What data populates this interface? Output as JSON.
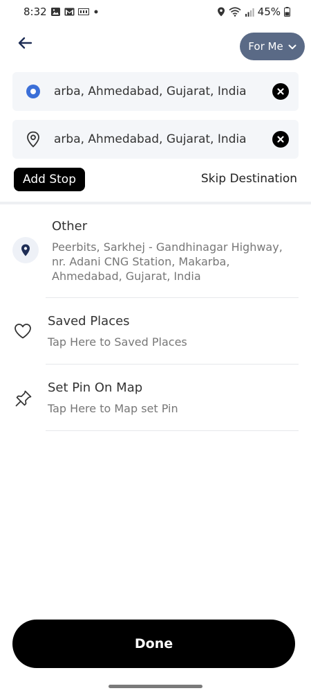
{
  "status_bar": {
    "time": "8:32",
    "battery": "45%",
    "left_icons": [
      "image-icon",
      "gmail-icon",
      "sim-icon",
      "dot-icon"
    ],
    "right_icons": [
      "location-icon",
      "wifi-icon",
      "signal-icon",
      "battery-icon"
    ]
  },
  "header": {
    "back_icon": "arrow-left-icon",
    "for_me_label": "For Me",
    "for_me_icon": "chevron-down-icon",
    "for_me_color": "#5a6a86"
  },
  "locations": {
    "pickup": {
      "value": "Makarba, Ahmedabad, Gujarat, India",
      "visible_value": "arba, Ahmedabad, Gujarat, India",
      "icon": "radio-dot-icon",
      "accent": "#3b6fd8"
    },
    "drop": {
      "value": "Makarba, Ahmedabad, Gujarat, India",
      "visible_value": "arba, Ahmedabad, Gujarat, India",
      "icon": "map-pin-icon"
    }
  },
  "actions": {
    "add_stop_label": "Add Stop",
    "skip_destination_label": "Skip Destination"
  },
  "suggestions": [
    {
      "title": "Other",
      "subtitle_lines": [
        "Peerbits, Sarkhej - Gandhinagar Highway,",
        "nr. Adani CNG Station, Makarba,",
        "Ahmedabad, Gujarat, India"
      ],
      "icon": "location-pin-icon"
    },
    {
      "title": "Saved Places",
      "subtitle_lines": [
        "Tap Here to Saved Places"
      ],
      "icon": "heart-icon"
    },
    {
      "title": "Set Pin On Map",
      "subtitle_lines": [
        "Tap Here to Map set Pin"
      ],
      "icon": "pushpin-icon"
    }
  ],
  "footer": {
    "done_label": "Done"
  }
}
